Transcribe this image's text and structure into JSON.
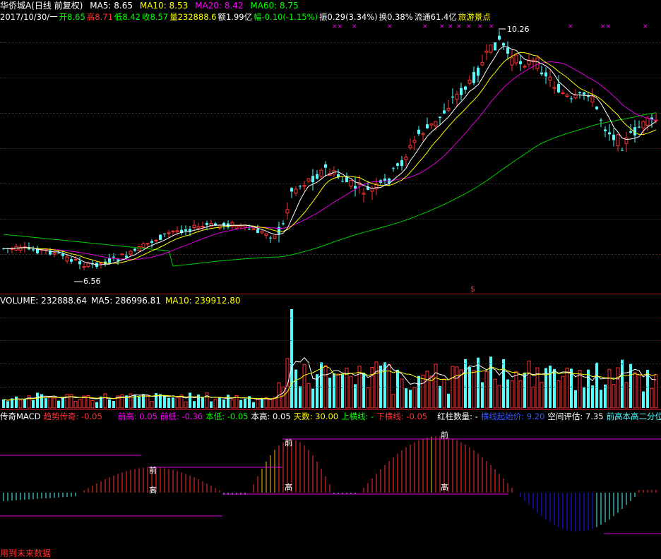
{
  "header": {
    "name": "华侨城A",
    "period": "(日线 前复权)",
    "ma5": "MA5: 8.65",
    "ma10": "MA10: 8.53",
    "ma20": "MA20: 8.42",
    "ma60": "MA60: 8.75"
  },
  "quote": {
    "date": "2017/10/30/一",
    "open": "开8.65",
    "high": "高8.71",
    "low": "低8.42",
    "close": "收8.57",
    "vol": "量232888.6",
    "amount": "额1.99亿",
    "change": "幅-0.10(-1.15%)",
    "amp": "振0.29(3.34%)",
    "turnover": "换0.38%",
    "float": "流通61.4亿",
    "sector": "旅游景点"
  },
  "main_chart": {
    "high_label": "10.26",
    "low_label": "6.56",
    "marker": "$"
  },
  "volume": {
    "vol": "VOLUME: 232888.64",
    "ma5": "MA5: 286996.81",
    "ma10": "MA10: 239912.80"
  },
  "macd": {
    "title": "传奇MACD",
    "trend": "趋势传奇: -0.05",
    "prev_high": "前高: 0.05",
    "prev_low": "前低: -0.36",
    "this_low": "本低: -0.05",
    "this_high": "本高: 0.05",
    "days": "天数: 30.00",
    "upper": "上横线: -",
    "lower": "下横线: -0.05",
    "red_count": "红柱数量: -",
    "start_price": "横线起始价: 9.20",
    "space": "空间评估: 7.35",
    "split": "前高本高二分位",
    "mark_prev": "前",
    "mark_high": "高"
  },
  "footer": "用到未来数据",
  "colors": {
    "bg": "#000000",
    "up": "#ff3232",
    "down": "#54ffff",
    "ma5": "#ffffff",
    "ma10": "#ffff00",
    "ma20": "#ff00ff",
    "ma60": "#00ff00",
    "grid": "#7a1a1a",
    "macd_neg": "#1a1aff",
    "macd_hi": "#ffc020"
  }
}
